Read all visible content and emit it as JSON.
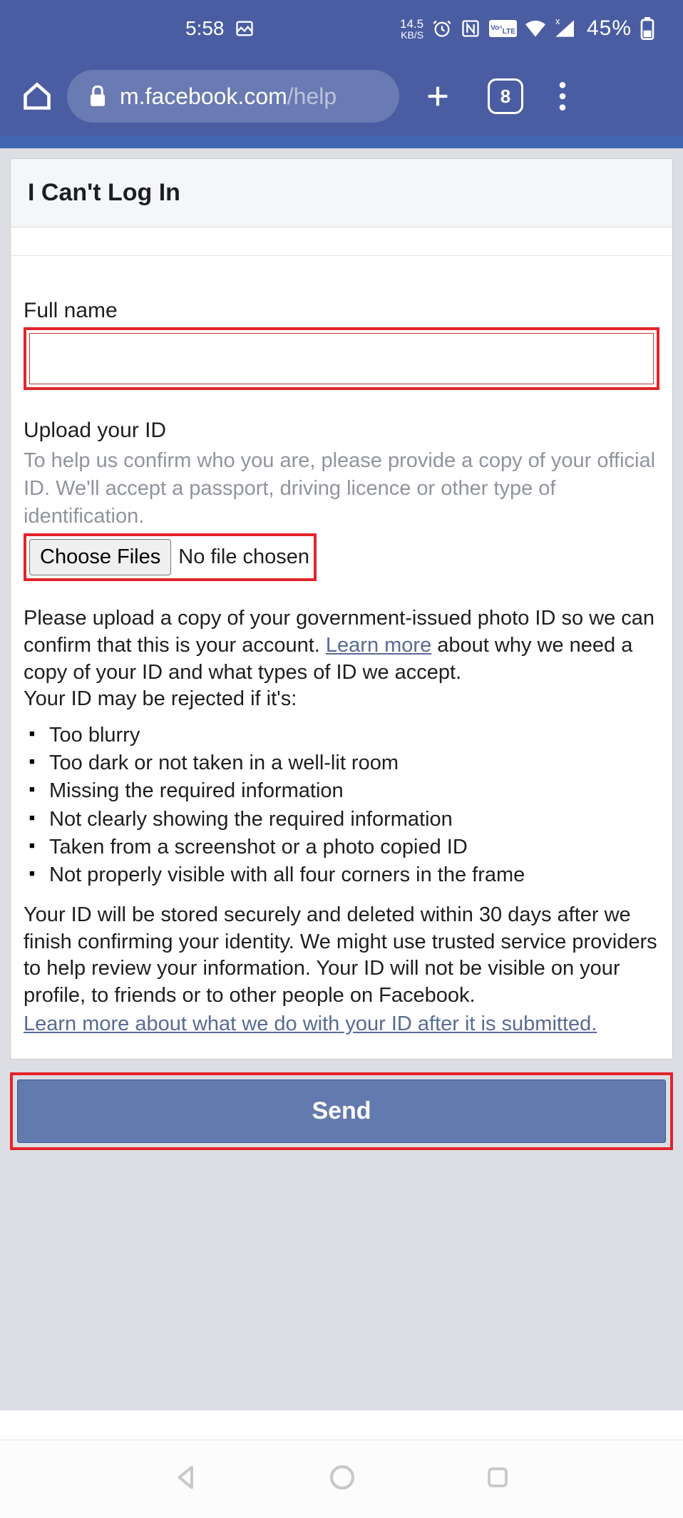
{
  "status": {
    "time": "5:58",
    "kbs_num": "14.5",
    "kbs_label": "KB/S",
    "volte": "Vo›LTE",
    "battery": "45%"
  },
  "browser": {
    "url_domain": "m.facebook.com",
    "url_path": "/help",
    "tab_count": "8"
  },
  "page": {
    "title": "I Can't Log In",
    "full_name_label": "Full name",
    "upload_label": "Upload your ID",
    "upload_help": "To help us confirm who you are, please provide a copy of your official ID. We'll accept a passport, driving licence or other type of identification.",
    "choose_files": "Choose Files",
    "no_file": "No file chosen",
    "body_1a": "Please upload a copy of your government-issued photo ID so we can confirm that this is your account. ",
    "learn_more_1": "Learn more",
    "body_1b": " about why we need a copy of your ID and what types of ID we accept.",
    "reject_intro": "Your ID may be rejected if it's:",
    "rejects": [
      "Too blurry",
      "Too dark or not taken in a well-lit room",
      "Missing the required information",
      "Not clearly showing the required information",
      "Taken from a screenshot or a photo copied ID",
      "Not properly visible with all four corners in the frame"
    ],
    "storage": "Your ID will be stored securely and deleted within 30 days after we finish confirming your identity. We might use trusted service providers to help review your information. Your ID will not be visible on your profile, to friends or to other people on Facebook.",
    "learn_more_2": "Learn more about what we do with your ID after it is submitted.",
    "send": "Send"
  }
}
